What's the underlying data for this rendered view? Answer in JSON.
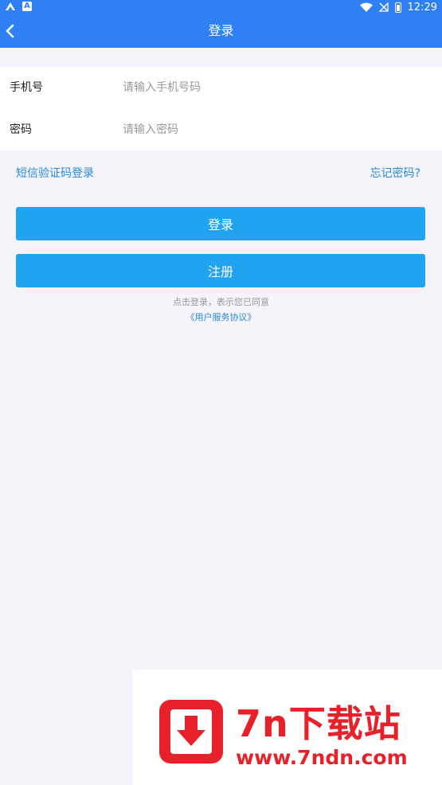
{
  "status_bar": {
    "time": "12:29",
    "icons": [
      "app-icon",
      "a-app-icon",
      "wifi-icon",
      "no-signal-icon",
      "battery-icon"
    ]
  },
  "navbar": {
    "title": "登录",
    "back_icon": "chevron-left-icon"
  },
  "form": {
    "phone": {
      "label": "手机号",
      "placeholder": "请输入手机号码",
      "value": ""
    },
    "password": {
      "label": "密码",
      "placeholder": "请输入密码",
      "value": ""
    }
  },
  "links": {
    "sms_login": "短信验证码登录",
    "forgot_password": "忘记密码?"
  },
  "buttons": {
    "login": "登录",
    "register": "注册"
  },
  "agreement": {
    "text": "点击登录，表示您已同意",
    "link": "《用户服务协议》"
  },
  "watermark": {
    "title": "7n下载站",
    "url": "www.7ndn.com"
  },
  "colors": {
    "primary": "#2f80f5",
    "button": "#21a3f0",
    "link": "#2a8ad8",
    "background": "#f4f4fa",
    "watermark_red": "#e8202a"
  }
}
